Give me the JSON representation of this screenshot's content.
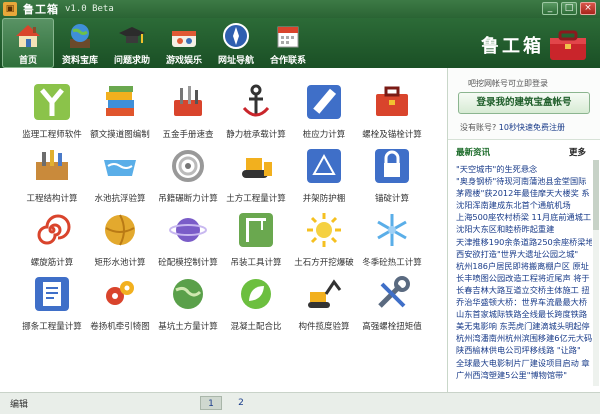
{
  "window": {
    "title": "鲁工箱",
    "version": "v1.0 Beta",
    "min_label": "_",
    "max_label": "□",
    "close_label": "×"
  },
  "nav": {
    "items": [
      {
        "label": "首页",
        "icon": "home-icon"
      },
      {
        "label": "资料宝库",
        "icon": "globe-icon"
      },
      {
        "label": "问题求助",
        "icon": "graduation-cap-icon"
      },
      {
        "label": "游戏娱乐",
        "icon": "game-icon"
      },
      {
        "label": "网址导航",
        "icon": "compass-icon"
      },
      {
        "label": "合作联系",
        "icon": "calendar-icon"
      }
    ]
  },
  "brand": "鲁工箱",
  "tools": {
    "rows": [
      [
        "监理工程师软件",
        "额文摸道图编制",
        "五金手册速查",
        "静力桩承载计算",
        "桩应力计算",
        "螺栓及锚栓计算"
      ],
      [
        "工程结构计算",
        "水池抗浮验算",
        "吊籍碾断力计算",
        "土方工程量计算",
        "并架防护棚",
        "锚碇计算"
      ],
      [
        "螺旋筋计算",
        "矩形水池计算",
        "砼配模控制计算",
        "吊装工具计算",
        "土石方开挖爆破",
        "冬季砼热工计算"
      ],
      [
        "挪条工程量计算",
        "卷扬机牵引犄图",
        "基坑土方量计算",
        "混凝土配合比",
        "构件揽度验算",
        "高强螺栓扭矩值"
      ]
    ]
  },
  "login": {
    "hint": "吧挖网帐号可立即登录",
    "button": "登录我的建筑宝盒帐号",
    "register_prefix": "没有账号?",
    "register_link": "10秒快速免费注册"
  },
  "news": {
    "title": "最新资讯",
    "more": "更多",
    "items": [
      "\"天空城市\"的生死悬念",
      "\"奥身钢桥\"待现河南蒲池县金堂国际",
      "茅霞楼\"获2012年最佳摩天大楼奖 系",
      "沈阳浑南建成东北首个通航机场",
      "上海500座农村桥梁 11月底前通城工",
      "沈阳大东区和睦桥昨起重建",
      "天津推移190余条道路250余座桥梁地",
      "西安欲打造\"世界大遗址公园之城\"",
      "杭州186户居民即将搬离棚户区 原址",
      "长丰喷图公园改造工程将近尾声 将于",
      "长春吉林大路互道立交桥主体施工 扭",
      "乔治华盛顿大桥：世界车流最最大桥",
      "山东首家城际铁路全线最长跨度铁路",
      "美无鬼影响 东莞虎门建滴城头明起停",
      "杭州湾潘南州杭州滨围移建6亿元大码",
      "陕西榆林供电公司坪移线路 \"让路\"",
      "全球最大电影制片厂建设项目启动 章",
      "广州西湾塑建5公里\"博物馆带\""
    ]
  },
  "footer": {
    "status": "编辑",
    "pages": [
      "1",
      "2"
    ]
  },
  "colors": {
    "header_bg": "#1f5a2e",
    "accent_green": "#2c6b37",
    "link_blue": "#1a3c8a"
  }
}
